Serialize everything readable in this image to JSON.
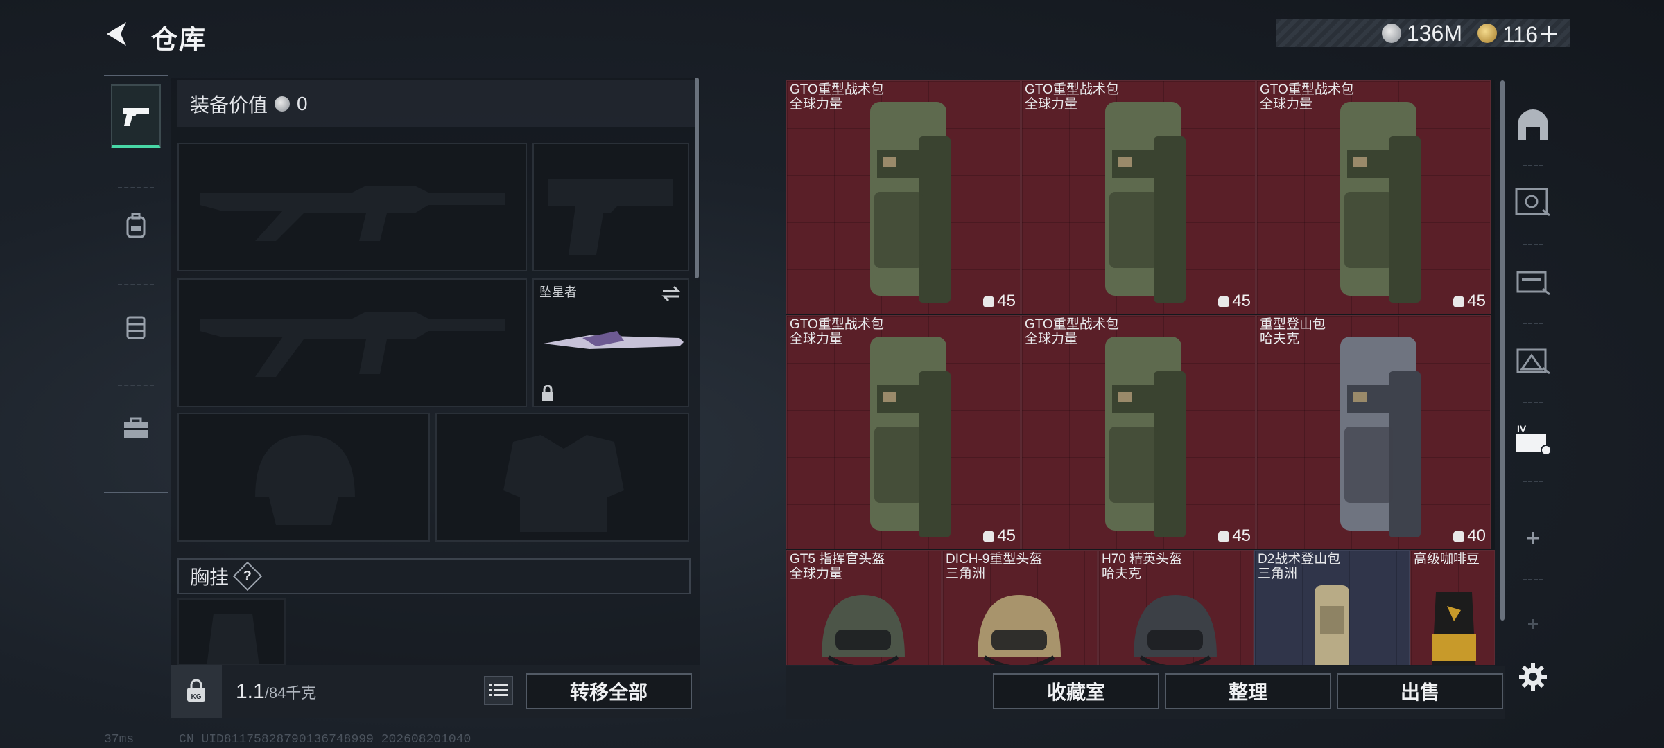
{
  "header": {
    "title": "仓库"
  },
  "currency": [
    {
      "icon": "silver-coin-icon",
      "value": "136M"
    },
    {
      "icon": "gold-coin-icon",
      "value": "116＋"
    }
  ],
  "categories": [
    {
      "name": "weapons",
      "icon": "pistol-icon",
      "active": true
    },
    {
      "name": "gear",
      "icon": "backpack-icon",
      "active": false
    },
    {
      "name": "supplies",
      "icon": "rig-icon",
      "active": false
    },
    {
      "name": "tools",
      "icon": "toolbox-icon",
      "active": false
    }
  ],
  "equipment": {
    "value_label": "装备价值",
    "value": "0",
    "melee_slot_label": "坠星者",
    "chest_label": "胸挂",
    "chest_help": "?"
  },
  "weight": {
    "current": "1.1",
    "max": "/84千克"
  },
  "buttons": {
    "transfer_all": "转移全部",
    "collection": "收藏室",
    "organize": "整理",
    "sell": "出售"
  },
  "storage_items": [
    {
      "name": "GTO重型战术包",
      "sub": "全球力量",
      "capacity": "45",
      "type": "backpack"
    },
    {
      "name": "GTO重型战术包",
      "sub": "全球力量",
      "capacity": "45",
      "type": "backpack"
    },
    {
      "name": "GTO重型战术包",
      "sub": "全球力量",
      "capacity": "45",
      "type": "backpack"
    },
    {
      "name": "GTO重型战术包",
      "sub": "全球力量",
      "capacity": "45",
      "type": "backpack"
    },
    {
      "name": "GTO重型战术包",
      "sub": "全球力量",
      "capacity": "45",
      "type": "backpack"
    },
    {
      "name": "重型登山包",
      "sub": "哈夫克",
      "capacity": "40",
      "type": "backpack-gray"
    },
    {
      "name": "GT5 指挥官头盔",
      "sub": "全球力量",
      "type": "helmet"
    },
    {
      "name": "DICH-9重型头盔",
      "sub": "三角洲",
      "type": "helmet-tan"
    },
    {
      "name": "H70 精英头盔",
      "sub": "哈夫克",
      "type": "helmet-dark"
    },
    {
      "name": "D2战术登山包",
      "sub": "三角洲",
      "type": "small-pack"
    },
    {
      "name": "高级咖啡豆",
      "sub": "",
      "type": "coffee"
    }
  ],
  "right_rail": [
    "storage-dome-icon",
    "vault-a-icon",
    "vault-b-icon",
    "vault-c-icon",
    "vault-iv-icon",
    "add-icon",
    "add-icon",
    "settings-icon"
  ],
  "status": {
    "ping": "37ms",
    "uid": "CN UID81175828790136748999 202608201040"
  },
  "colors": {
    "accent": "#48d7a6",
    "item_bg": "#5a1f28",
    "item_bg_alt": "#30354a"
  }
}
